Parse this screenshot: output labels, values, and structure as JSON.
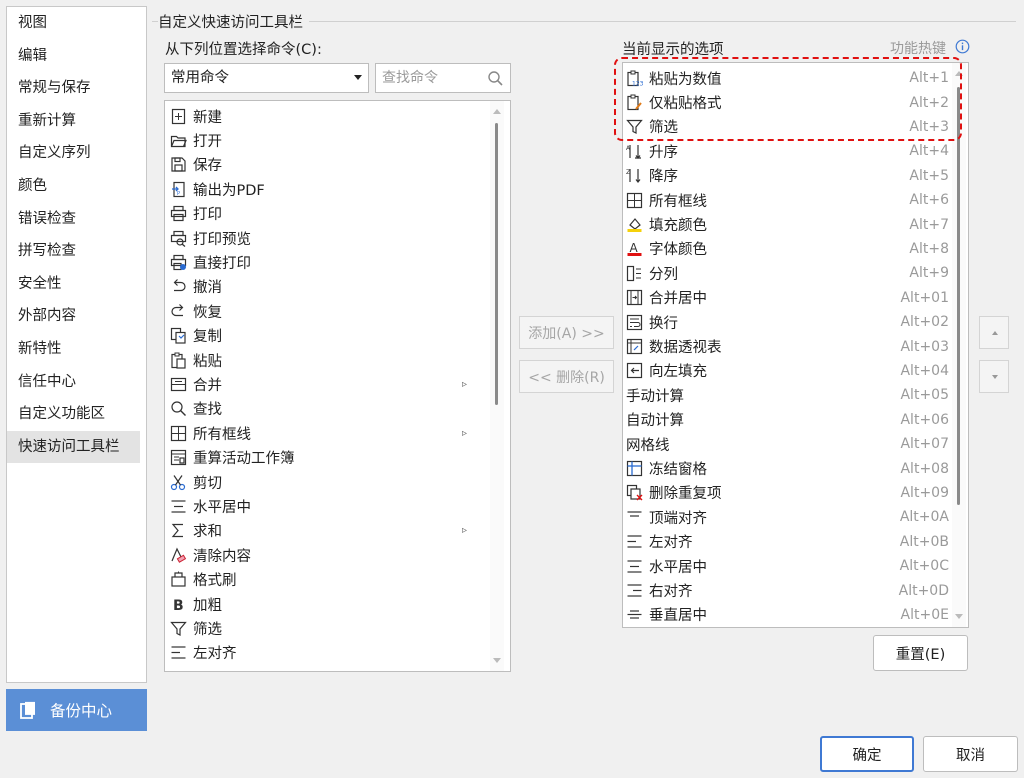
{
  "nav": {
    "items": [
      {
        "label": "视图"
      },
      {
        "label": "编辑"
      },
      {
        "label": "常规与保存"
      },
      {
        "label": "重新计算"
      },
      {
        "label": "自定义序列"
      },
      {
        "label": "颜色"
      },
      {
        "label": "错误检查"
      },
      {
        "label": "拼写检查"
      },
      {
        "label": "安全性"
      },
      {
        "label": "外部内容"
      },
      {
        "label": "新特性"
      },
      {
        "label": "信任中心"
      },
      {
        "label": "自定义功能区"
      },
      {
        "label": "快速访问工具栏"
      }
    ],
    "active_index": 13,
    "backup_label": "备份中心"
  },
  "main": {
    "section_title": "自定义快速访问工具栏",
    "choose_label": "从下列位置选择命令(C):",
    "select_value": "常用命令",
    "search_placeholder": "查找命令",
    "current_label": "当前显示的选项",
    "hotkey_label": "功能热键",
    "add_label": "添加(A) >>",
    "remove_label": "<< 删除(R)",
    "reset_label": "重置(E)",
    "ok_label": "确定",
    "cancel_label": "取消"
  },
  "left_list": [
    {
      "label": "新建",
      "icon": "new-file-icon"
    },
    {
      "label": "打开",
      "icon": "folder-open-icon"
    },
    {
      "label": "保存",
      "icon": "save-icon"
    },
    {
      "label": "输出为PDF",
      "icon": "pdf-export-icon"
    },
    {
      "label": "打印",
      "icon": "printer-icon"
    },
    {
      "label": "打印预览",
      "icon": "print-preview-icon"
    },
    {
      "label": "直接打印",
      "icon": "direct-print-icon"
    },
    {
      "label": "撤消",
      "icon": "undo-icon"
    },
    {
      "label": "恢复",
      "icon": "redo-icon"
    },
    {
      "label": "复制",
      "icon": "copy-icon"
    },
    {
      "label": "粘贴",
      "icon": "paste-icon"
    },
    {
      "label": "合并",
      "icon": "merge-icon",
      "submenu": "▹"
    },
    {
      "label": "查找",
      "icon": "find-icon"
    },
    {
      "label": "所有框线",
      "icon": "all-borders-icon",
      "submenu": "▹"
    },
    {
      "label": "重算活动工作簿",
      "icon": "recalc-icon"
    },
    {
      "label": "剪切",
      "icon": "scissors-icon"
    },
    {
      "label": "水平居中",
      "icon": "align-center-icon"
    },
    {
      "label": "求和",
      "icon": "sum-icon",
      "submenu": "▹"
    },
    {
      "label": "清除内容",
      "icon": "eraser-icon"
    },
    {
      "label": "格式刷",
      "icon": "format-painter-icon"
    },
    {
      "label": "加粗",
      "icon": "bold-icon"
    },
    {
      "label": "筛选",
      "icon": "filter-icon"
    },
    {
      "label": "左对齐",
      "icon": "align-left-icon"
    }
  ],
  "right_list": [
    {
      "label": "粘贴为数值",
      "hotkey": "Alt+1",
      "icon": "paste-values-icon"
    },
    {
      "label": "仅粘贴格式",
      "hotkey": "Alt+2",
      "icon": "paste-format-icon"
    },
    {
      "label": "筛选",
      "hotkey": "Alt+3",
      "icon": "filter-icon"
    },
    {
      "label": "升序",
      "hotkey": "Alt+4",
      "icon": "sort-asc-icon"
    },
    {
      "label": "降序",
      "hotkey": "Alt+5",
      "icon": "sort-desc-icon"
    },
    {
      "label": "所有框线",
      "hotkey": "Alt+6",
      "icon": "all-borders-icon"
    },
    {
      "label": "填充颜色",
      "hotkey": "Alt+7",
      "icon": "fill-color-icon"
    },
    {
      "label": "字体颜色",
      "hotkey": "Alt+8",
      "icon": "font-color-icon"
    },
    {
      "label": "分列",
      "hotkey": "Alt+9",
      "icon": "split-columns-icon"
    },
    {
      "label": "合并居中",
      "hotkey": "Alt+01",
      "icon": "merge-center-icon"
    },
    {
      "label": "换行",
      "hotkey": "Alt+02",
      "icon": "wrap-text-icon"
    },
    {
      "label": "数据透视表",
      "hotkey": "Alt+03",
      "icon": "pivot-table-icon"
    },
    {
      "label": "向左填充",
      "hotkey": "Alt+04",
      "icon": "fill-left-icon"
    },
    {
      "label": "手动计算",
      "hotkey": "Alt+05",
      "icon": ""
    },
    {
      "label": "自动计算",
      "hotkey": "Alt+06",
      "icon": ""
    },
    {
      "label": "网格线",
      "hotkey": "Alt+07",
      "icon": ""
    },
    {
      "label": "冻结窗格",
      "hotkey": "Alt+08",
      "icon": "freeze-panes-icon"
    },
    {
      "label": "删除重复项",
      "hotkey": "Alt+09",
      "icon": "remove-duplicates-icon"
    },
    {
      "label": "顶端对齐",
      "hotkey": "Alt+0A",
      "icon": "align-top-icon"
    },
    {
      "label": "左对齐",
      "hotkey": "Alt+0B",
      "icon": "align-left-icon"
    },
    {
      "label": "水平居中",
      "hotkey": "Alt+0C",
      "icon": "align-center-icon"
    },
    {
      "label": "右对齐",
      "hotkey": "Alt+0D",
      "icon": "align-right-icon"
    },
    {
      "label": "垂直居中",
      "hotkey": "Alt+0E",
      "icon": "align-middle-icon"
    }
  ],
  "colors": {
    "accent": "#3f79d3",
    "backup_bg": "#5b8fd6",
    "highlight": "#e01010",
    "fill_yellow": "#f5d10a",
    "font_red": "#e01010"
  }
}
